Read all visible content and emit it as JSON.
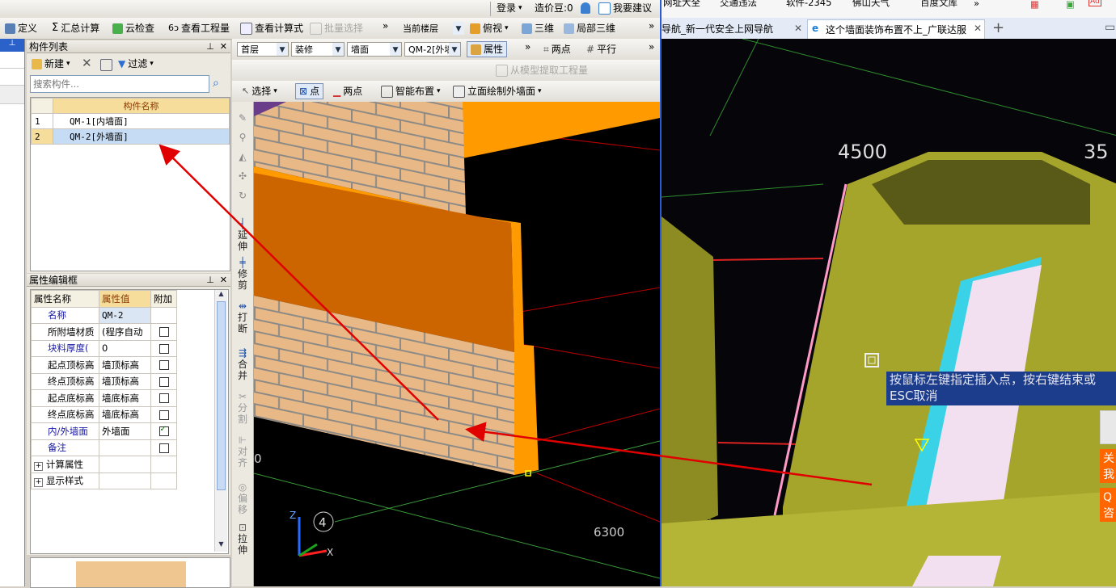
{
  "topbar": {
    "login": "登录",
    "beans": "造价豆:0",
    "suggest": "我要建议"
  },
  "toolbar1": {
    "define": "定义",
    "sum": "汇总计算",
    "cloud_check": "云检查",
    "view_project": "查看工程量",
    "view_formula": "查看计算式",
    "batch_select": "批量选择",
    "floor_select": "当前楼层",
    "view_mode": "俯视",
    "three_d": "三维",
    "local_3d": "局部三维"
  },
  "toolbar2": {
    "floor": "首层",
    "category": "装修",
    "type": "墙面",
    "component": "QM-2[外墙",
    "property_btn": "属性",
    "two_point": "两点",
    "parallel": "平行"
  },
  "toolbar3": {
    "extract": "从模型提取工程量"
  },
  "toolbar4": {
    "select": "选择",
    "point": "点",
    "two_point": "两点",
    "smart_layout": "智能布置",
    "elevation": "立面绘制外墙面"
  },
  "component_panel": {
    "title": "构件列表",
    "new_label": "新建",
    "filter_label": "过滤",
    "search_placeholder": "搜索构件...",
    "column_header": "构件名称",
    "rows": [
      {
        "idx": "1",
        "name": "QM-1[内墙面]"
      },
      {
        "idx": "2",
        "name": "QM-2[外墙面]"
      }
    ]
  },
  "property_panel": {
    "title": "属性编辑框",
    "headers": {
      "name": "属性名称",
      "value": "属性值",
      "extra": "附加"
    },
    "rows": [
      {
        "name": "名称",
        "value": "QM-2",
        "check": null,
        "blue": true
      },
      {
        "name": "所附墙材质",
        "value": "(程序自动",
        "check": false,
        "blue": false
      },
      {
        "name": "块料厚度(",
        "value": "0",
        "check": false,
        "blue": true
      },
      {
        "name": "起点顶标高",
        "value": "墙顶标高",
        "check": false,
        "blue": false
      },
      {
        "name": "终点顶标高",
        "value": "墙顶标高",
        "check": false,
        "blue": false
      },
      {
        "name": "起点底标高",
        "value": "墙底标高",
        "check": false,
        "blue": false
      },
      {
        "name": "终点底标高",
        "value": "墙底标高",
        "check": false,
        "blue": false
      },
      {
        "name": "内/外墙面",
        "value": "外墙面",
        "check": true,
        "blue": true
      },
      {
        "name": "备注",
        "value": "",
        "check": false,
        "blue": true
      },
      {
        "name": "计算属性",
        "value": "",
        "check": null,
        "blue": false,
        "expand": true
      },
      {
        "name": "显示样式",
        "value": "",
        "check": null,
        "blue": false,
        "expand": true
      }
    ]
  },
  "vertical_tools": {
    "extend": "延伸",
    "trim": "修剪",
    "break": "打断",
    "merge": "合并",
    "split": "分割",
    "align": "对齐",
    "offset": "偏移",
    "stretch": "拉伸"
  },
  "viewport": {
    "dim_a": "0",
    "dim_b": "6300",
    "axis_num": "4",
    "axis_z": "Z",
    "axis_x": "X"
  },
  "browser": {
    "bookmarks": [
      "网址大全",
      "交通违法",
      "软件-2345",
      "佛山天气",
      "百度文库"
    ],
    "tabs": [
      "导航_新一代安全上网导航",
      "这个墙面装饰布置不上_广联达服"
    ],
    "dim1": "4500",
    "dim2": "35",
    "hint": "按鼠标左键指定插入点，按右键结束或ESC取消",
    "side1": "关我",
    "side2": "Q咨"
  },
  "colors": {
    "accent": "#ff0000",
    "orange": "#ff9900",
    "selected_row": "#c6dcf4"
  }
}
